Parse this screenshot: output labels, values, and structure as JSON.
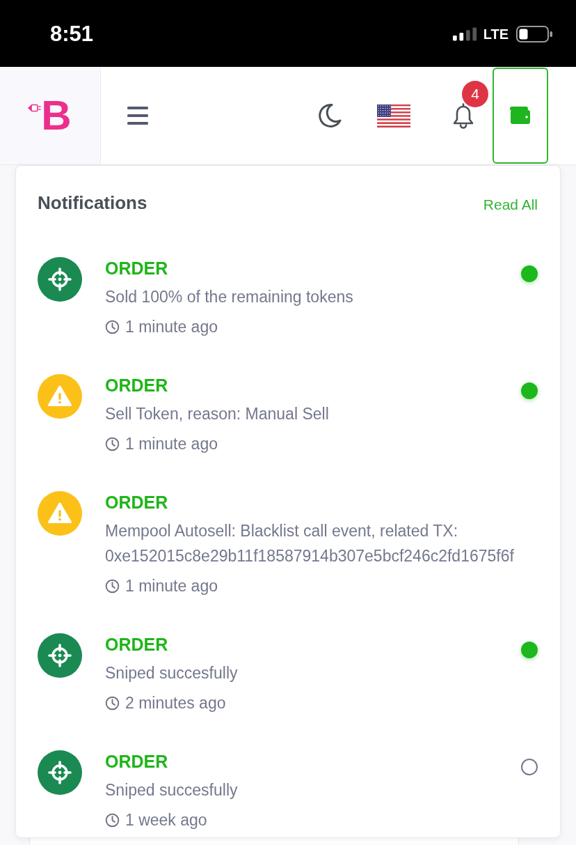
{
  "status_bar": {
    "time": "8:51",
    "network": "LTE"
  },
  "header": {
    "logo": "B",
    "notification_count": "4"
  },
  "notifications": {
    "title": "Notifications",
    "action": "Read All",
    "items": [
      {
        "kind": "success",
        "title": "ORDER",
        "message": "Sold 100% of the remaining tokens",
        "time": "1 minute ago",
        "unread": true
      },
      {
        "kind": "warning",
        "title": "ORDER",
        "message": "Sell Token, reason: Manual Sell",
        "time": "1 minute ago",
        "unread": true
      },
      {
        "kind": "warning",
        "title": "ORDER",
        "message": "Mempool Autosell: Blacklist call event, related TX: 0xe152015c8e29b11f18587914b307e5bcf246c2fd1675f6f",
        "time": "1 minute ago"
      },
      {
        "kind": "success",
        "title": "ORDER",
        "message": "Sniped succesfully",
        "time": "2 minutes ago",
        "unread": true
      },
      {
        "kind": "success",
        "title": "ORDER",
        "message": "Sniped succesfully",
        "time": "1 week ago",
        "unread": false
      }
    ]
  }
}
